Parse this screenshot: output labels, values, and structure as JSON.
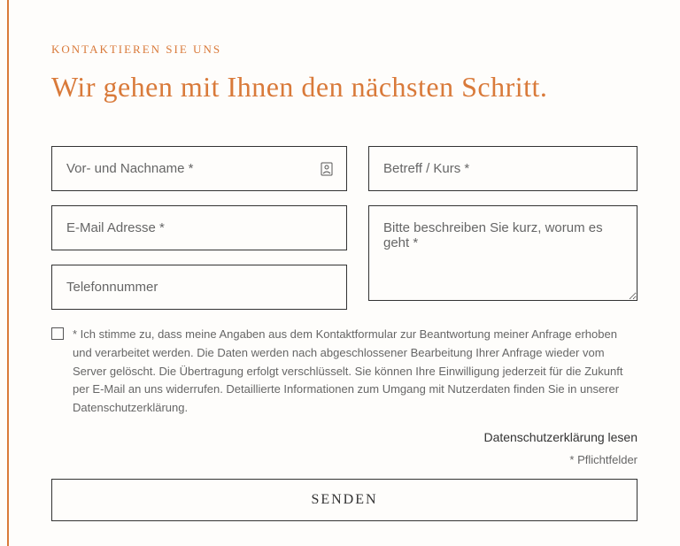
{
  "eyebrow": "KONTAKTIEREN SIE UNS",
  "heading": "Wir gehen mit Ihnen den nächsten Schritt.",
  "fields": {
    "name": {
      "placeholder": "Vor- und Nachname *"
    },
    "subject": {
      "placeholder": "Betreff / Kurs *"
    },
    "email": {
      "placeholder": "E-Mail Adresse *"
    },
    "phone": {
      "placeholder": "Telefonnummer"
    },
    "message": {
      "placeholder": "Bitte beschreiben Sie kurz, worum es geht *"
    }
  },
  "consent": {
    "text": "* Ich stimme zu, dass meine Angaben aus dem Kontaktformular zur Beantwortung meiner Anfrage erhoben und verarbeitet werden. Die Daten werden nach abgeschlossener Bearbeitung Ihrer Anfrage wieder vom Server gelöscht. Die Übertragung erfolgt verschlüsselt. Sie können Ihre Einwilligung jederzeit für die Zukunft per E-Mail an uns widerrufen. Detaillierte Informationen zum Umgang mit Nutzerdaten finden Sie in unserer Datenschutzerklärung."
  },
  "privacyLink": "Datenschutzerklärung lesen",
  "requiredNote": "* Pflichtfelder",
  "submitLabel": "SENDEN"
}
